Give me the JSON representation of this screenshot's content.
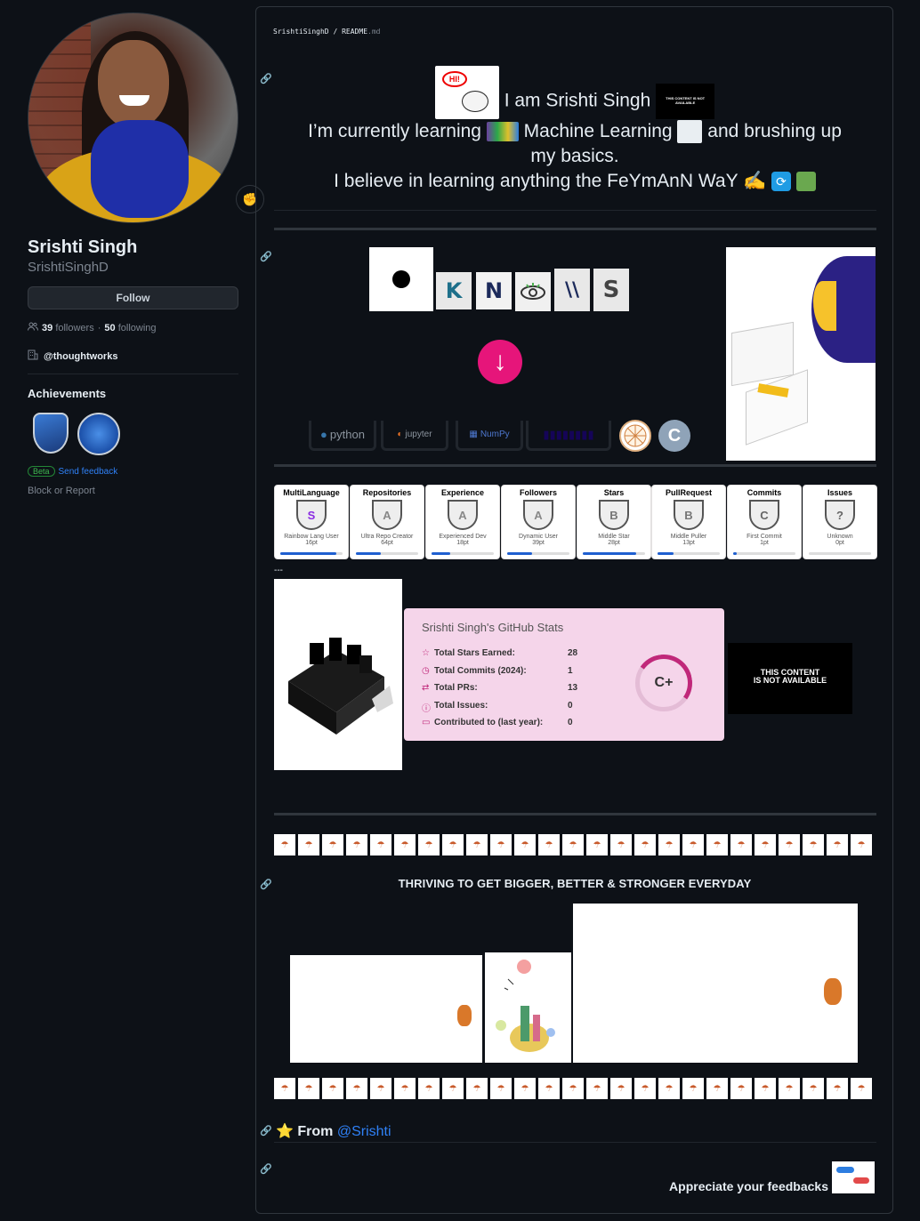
{
  "profile": {
    "name": "Srishti Singh",
    "login": "SrishtiSinghD",
    "follow_label": "Follow",
    "followers_count": "39",
    "followers_label": "followers",
    "separator": "·",
    "following_count": "50",
    "following_label": "following",
    "organization": "@thoughtworks",
    "achievements_title": "Achievements",
    "beta_label": "Beta",
    "feedback_label": "Send feedback",
    "block_label": "Block or Report",
    "status_icon": "flexed-biceps-icon"
  },
  "readme": {
    "breadcrumb_user": "SrishtiSinghD",
    "breadcrumb_sep": "/",
    "breadcrumb_file": "README",
    "breadcrumb_ext": ".md",
    "anchor_icon": "🔗",
    "hi_text": "HI!",
    "intro_line1": "I am Srishti Singh",
    "intro_line2a": "I’m currently learning",
    "intro_line2b": "Machine Learning",
    "intro_line2c": "and brushing up",
    "intro_line3": "my basics.",
    "intro_line4": "I believe in learning anything the FeYmAnN WaY",
    "na_mini_text": "THIS CONTENT IS NOT AVAILABLE",
    "tech_python": "python",
    "tech_jupyter": "jupyter",
    "tech_numpy": "NumPy",
    "tech_c": "C",
    "logo_letters": [
      "K",
      "N",
      "\\\\",
      "S"
    ],
    "down_arrow": "↓",
    "stats_dashes": "---",
    "stats": {
      "title": "Srishti Singh's GitHub Stats",
      "rows": [
        {
          "icon": "☆",
          "label": "Total Stars Earned:",
          "value": "28"
        },
        {
          "icon": "◷",
          "label": "Total Commits (2024):",
          "value": "1"
        },
        {
          "icon": "⇄",
          "label": "Total PRs:",
          "value": "13"
        },
        {
          "icon": "ⓘ",
          "label": "Total Issues:",
          "value": "0"
        },
        {
          "icon": "▭",
          "label": "Contributed to (last year):",
          "value": "0"
        }
      ],
      "grade": "C+",
      "accent": "#c0287a",
      "background": "#f5d5ea"
    },
    "na_big_line1": "THIS CONTENT",
    "na_big_line2": "IS NOT AVAILABLE",
    "trophies": [
      {
        "title": "MultiLanguage",
        "rank": "S",
        "name": "Rainbow Lang User",
        "points": "16pt",
        "progress": 0.9
      },
      {
        "title": "Repositories",
        "rank": "A",
        "name": "Ultra Repo Creator",
        "points": "64pt",
        "progress": 0.4
      },
      {
        "title": "Experience",
        "rank": "A",
        "name": "Experienced Dev",
        "points": "18pt",
        "progress": 0.3
      },
      {
        "title": "Followers",
        "rank": "A",
        "name": "Dynamic User",
        "points": "39pt",
        "progress": 0.4
      },
      {
        "title": "Stars",
        "rank": "B",
        "name": "Middle Star",
        "points": "28pt",
        "progress": 0.85
      },
      {
        "title": "PullRequest",
        "rank": "B",
        "name": "Middle Puller",
        "points": "13pt",
        "progress": 0.25
      },
      {
        "title": "Commits",
        "rank": "C",
        "name": "First Commit",
        "points": "1pt",
        "progress": 0.05
      },
      {
        "title": "Issues",
        "rank": "?",
        "name": "Unknown",
        "points": "0pt",
        "progress": 0.0
      }
    ],
    "thriving": "THRIVING TO GET BIGGER, BETTER & STRONGER EVERYDAY",
    "from_label": "From",
    "from_link": "@Srishti",
    "from_icon": "⭐",
    "appreciate": "Appreciate your feedbacks"
  }
}
